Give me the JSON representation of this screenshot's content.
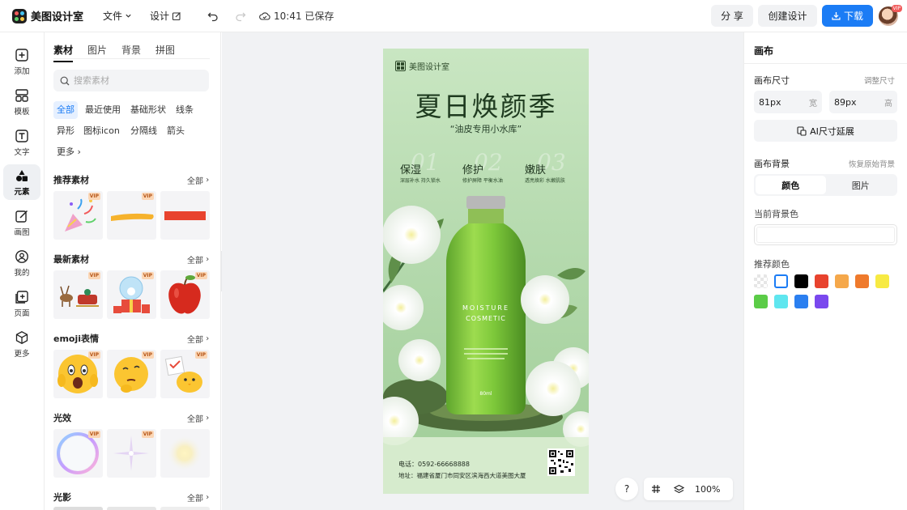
{
  "header": {
    "brand": "美图设计室",
    "file_menu": "文件",
    "design_menu": "设计",
    "saved_status": "10:41 已保存",
    "share_label": "分 享",
    "create_label": "创建设计",
    "download_label": "下载",
    "avatar_badge": "VIP"
  },
  "leftbar": {
    "items": [
      {
        "label": "添加",
        "icon": "plus-square-icon"
      },
      {
        "label": "模板",
        "icon": "template-icon"
      },
      {
        "label": "文字",
        "icon": "text-icon"
      },
      {
        "label": "元素",
        "icon": "element-icon"
      },
      {
        "label": "画图",
        "icon": "draw-icon"
      },
      {
        "label": "我的",
        "icon": "user-icon"
      },
      {
        "label": "页面",
        "icon": "page-add-icon"
      },
      {
        "label": "更多",
        "icon": "cube-icon"
      }
    ],
    "active": "元素"
  },
  "panel": {
    "tabs": [
      "素材",
      "图片",
      "背景",
      "拼图"
    ],
    "active_tab": "素材",
    "search_placeholder": "搜索素材",
    "chips": [
      "全部",
      "最近使用",
      "基础形状",
      "线条",
      "异形",
      "图标icon",
      "分隔线",
      "箭头",
      "更多"
    ],
    "active_chip": "全部",
    "vip_badge": "VIP",
    "all_label": "全部",
    "sections": [
      {
        "title": "推荐素材",
        "items": [
          "party-popper",
          "yellow-stroke",
          "red-bar"
        ]
      },
      {
        "title": "最新素材",
        "items": [
          "reindeer-sleigh",
          "snow-globe-gifts",
          "red-apple"
        ]
      },
      {
        "title": "emoji表情",
        "items": [
          "shocked-emoji",
          "thinking-emoji",
          "chick-emoji"
        ]
      },
      {
        "title": "光效",
        "items": [
          "bubble-ring",
          "star-sparkle",
          "light-glow"
        ]
      },
      {
        "title": "光影",
        "items": []
      }
    ]
  },
  "poster": {
    "brand": "美图设计室",
    "title": "夏日焕颜季",
    "subtitle": "“油皮专用小水库”",
    "features": [
      {
        "num": "01",
        "label": "保湿",
        "desc": "深层补水 持久锁水"
      },
      {
        "num": "02",
        "label": "修护",
        "desc": "修护屏障 平衡水油"
      },
      {
        "num": "03",
        "label": "嫩肤",
        "desc": "透亮焕彩 水嫩肌肤"
      }
    ],
    "bottle_line1": "MOISTURE",
    "bottle_line2": "COSMETIC",
    "bottle_volume": "80ml",
    "phone": "电话：0592-66668888",
    "address": "地址：福建省厦门市同安区滨海西大道美图大厦"
  },
  "canvas_controls": {
    "help": "?",
    "zoom": "100%"
  },
  "rpanel": {
    "title": "画布",
    "size_label": "画布尺寸",
    "adjust_size": "调整尺寸",
    "width_value": "81px",
    "width_unit": "宽",
    "height_value": "89px",
    "height_unit": "高",
    "ai_button": "AI尺寸延展",
    "bg_label": "画布背景",
    "restore_bg": "恢复原始背景",
    "seg_color": "颜色",
    "seg_image": "图片",
    "current_bg_label": "当前背景色",
    "recommended_label": "推荐颜色",
    "colors": [
      "transparent",
      "#ffffff",
      "#000000",
      "#e8432e",
      "#f5a84b",
      "#ef7a2c",
      "#f7ea43",
      "#5bcc47",
      "#5fe6ef",
      "#2b7ff0",
      "#7a48ee"
    ]
  }
}
